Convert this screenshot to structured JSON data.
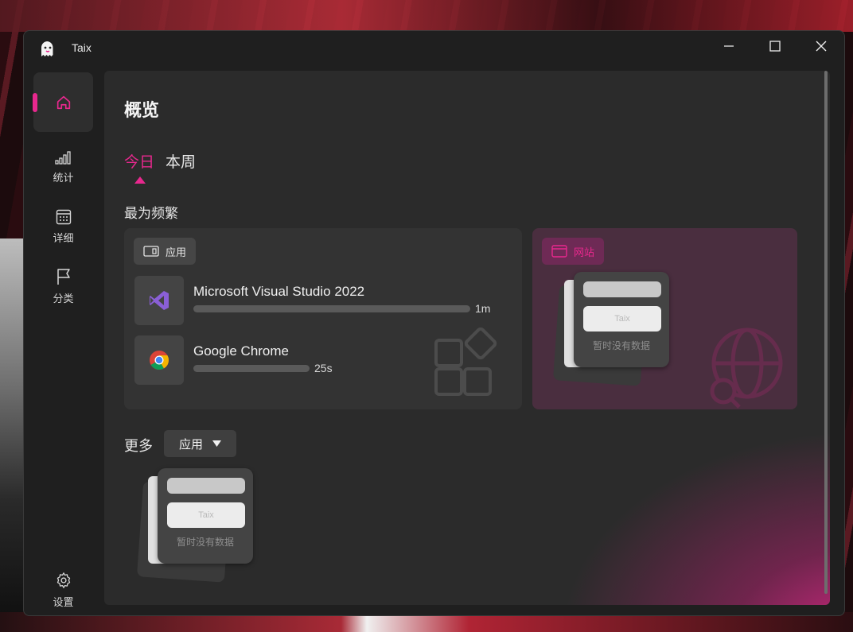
{
  "window": {
    "title": "Taix"
  },
  "sidebar": {
    "items": [
      {
        "id": "overview",
        "label": "",
        "icon": "home-icon",
        "active": true
      },
      {
        "id": "stats",
        "label": "统计",
        "icon": "signal-bars-icon"
      },
      {
        "id": "details",
        "label": "详细",
        "icon": "calendar-icon"
      },
      {
        "id": "category",
        "label": "分类",
        "icon": "flag-icon"
      },
      {
        "id": "settings",
        "label": "设置",
        "icon": "gear-icon"
      }
    ]
  },
  "main": {
    "title": "概览",
    "tabs": [
      {
        "label": "今日",
        "active": true
      },
      {
        "label": "本周",
        "active": false
      }
    ],
    "frequent": {
      "title": "最为频繁",
      "apps_card": {
        "chip_label": "应用",
        "items": [
          {
            "name": "Microsoft Visual Studio 2022",
            "value": "1m",
            "icon": "visual-studio-icon",
            "share": 1.0
          },
          {
            "name": "Google Chrome",
            "value": "25s",
            "icon": "chrome-icon",
            "share": 0.42
          }
        ]
      },
      "web_card": {
        "chip_label": "网站",
        "empty": {
          "logo_text": "Taix",
          "caption": "暂时没有数据"
        }
      }
    },
    "more": {
      "label": "更多",
      "dropdown_value": "应用",
      "empty": {
        "logo_text": "Taix",
        "caption": "暂时没有数据"
      }
    }
  },
  "colors": {
    "accent": "#e8288e",
    "background": "#1f1f1f",
    "panel": "#2b2b2b",
    "card": "#333333"
  }
}
